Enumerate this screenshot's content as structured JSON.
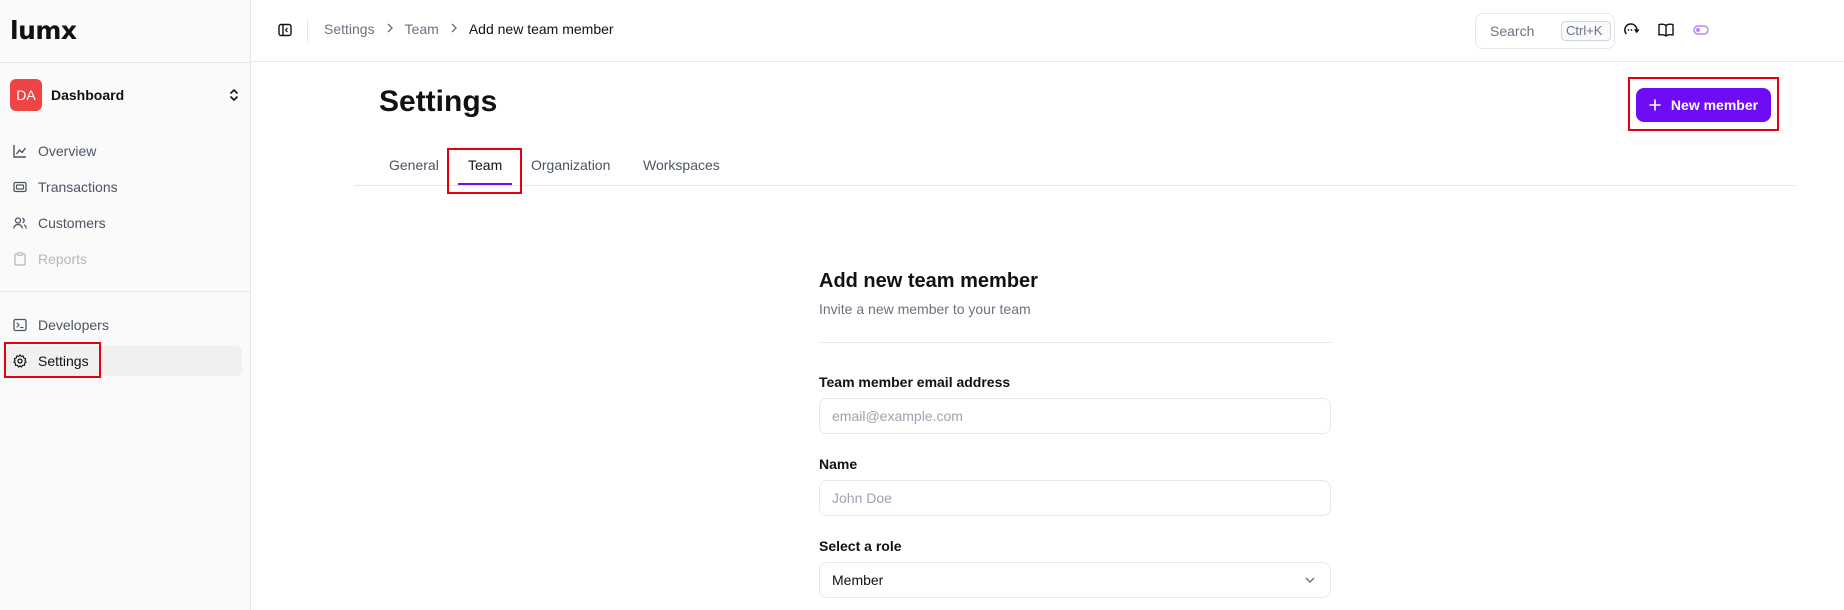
{
  "app": {
    "logo": "lumx"
  },
  "org": {
    "initials": "DA",
    "name": "Dashboard"
  },
  "sidebar": {
    "items": [
      {
        "label": "Overview",
        "icon": "chart-icon"
      },
      {
        "label": "Transactions",
        "icon": "transactions-icon"
      },
      {
        "label": "Customers",
        "icon": "users-icon"
      },
      {
        "label": "Reports",
        "icon": "clipboard-icon",
        "disabled": true
      },
      {
        "label": "Developers",
        "icon": "terminal-icon"
      },
      {
        "label": "Settings",
        "icon": "gear-icon",
        "active": true
      }
    ]
  },
  "breadcrumb": [
    "Settings",
    "Team",
    "Add new team member"
  ],
  "topbar": {
    "search_placeholder": "Search",
    "shortcut": "Ctrl+K"
  },
  "page": {
    "title": "Settings",
    "new_member_label": "New member",
    "tabs": [
      {
        "label": "General"
      },
      {
        "label": "Team",
        "active": true
      },
      {
        "label": "Organization"
      },
      {
        "label": "Workspaces"
      }
    ]
  },
  "form": {
    "title": "Add new team member",
    "subtitle": "Invite a new member to your team",
    "email_label": "Team member email address",
    "email_placeholder": "email@example.com",
    "name_label": "Name",
    "name_placeholder": "John Doe",
    "role_label": "Select a role",
    "role_value": "Member"
  },
  "colors": {
    "accent": "#6d0cf5",
    "avatar": "#ef4444",
    "highlight": "#e3000f"
  }
}
